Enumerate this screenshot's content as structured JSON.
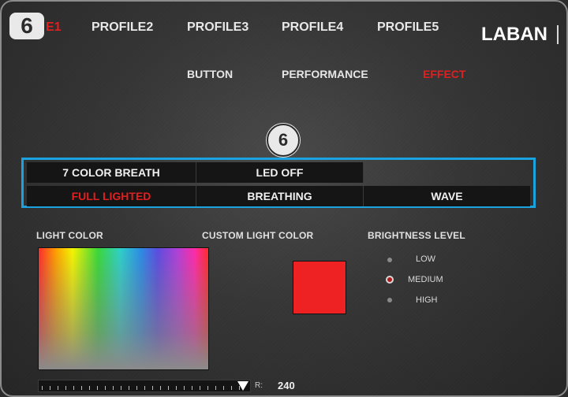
{
  "step_badge": "6",
  "step_marker": "6",
  "profile_tabs": [
    {
      "label": "E1",
      "active": true
    },
    {
      "label": "PROFILE2",
      "active": false
    },
    {
      "label": "PROFILE3",
      "active": false
    },
    {
      "label": "PROFILE4",
      "active": false
    },
    {
      "label": "PROFILE5",
      "active": false
    }
  ],
  "brand": "LABAN",
  "sub_tabs": [
    {
      "label": "BUTTON",
      "active": false
    },
    {
      "label": "PERFORMANCE",
      "active": false
    },
    {
      "label": "EFFECT",
      "active": true
    }
  ],
  "effect_options": {
    "row1": [
      {
        "label": "7 COLOR BREATH",
        "active": false
      },
      {
        "label": "LED OFF",
        "active": false
      }
    ],
    "row2": [
      {
        "label": "FULL LIGHTED",
        "active": true
      },
      {
        "label": "BREATHING",
        "active": false
      },
      {
        "label": "WAVE",
        "active": false
      }
    ]
  },
  "light_color": {
    "label": "LIGHT COLOR",
    "channel_label": "R:",
    "channel_value": "240"
  },
  "custom_light_color": {
    "label": "CUSTOM LIGHT COLOR",
    "color": "#ee2222"
  },
  "brightness": {
    "label": "BRIGHTNESS LEVEL",
    "options": [
      {
        "label": "LOW",
        "selected": false
      },
      {
        "label": "MEDIUM",
        "selected": true
      },
      {
        "label": "HIGH",
        "selected": false
      }
    ]
  },
  "colors": {
    "accent_red": "#e02020",
    "highlight_blue": "#1ba3e0"
  }
}
